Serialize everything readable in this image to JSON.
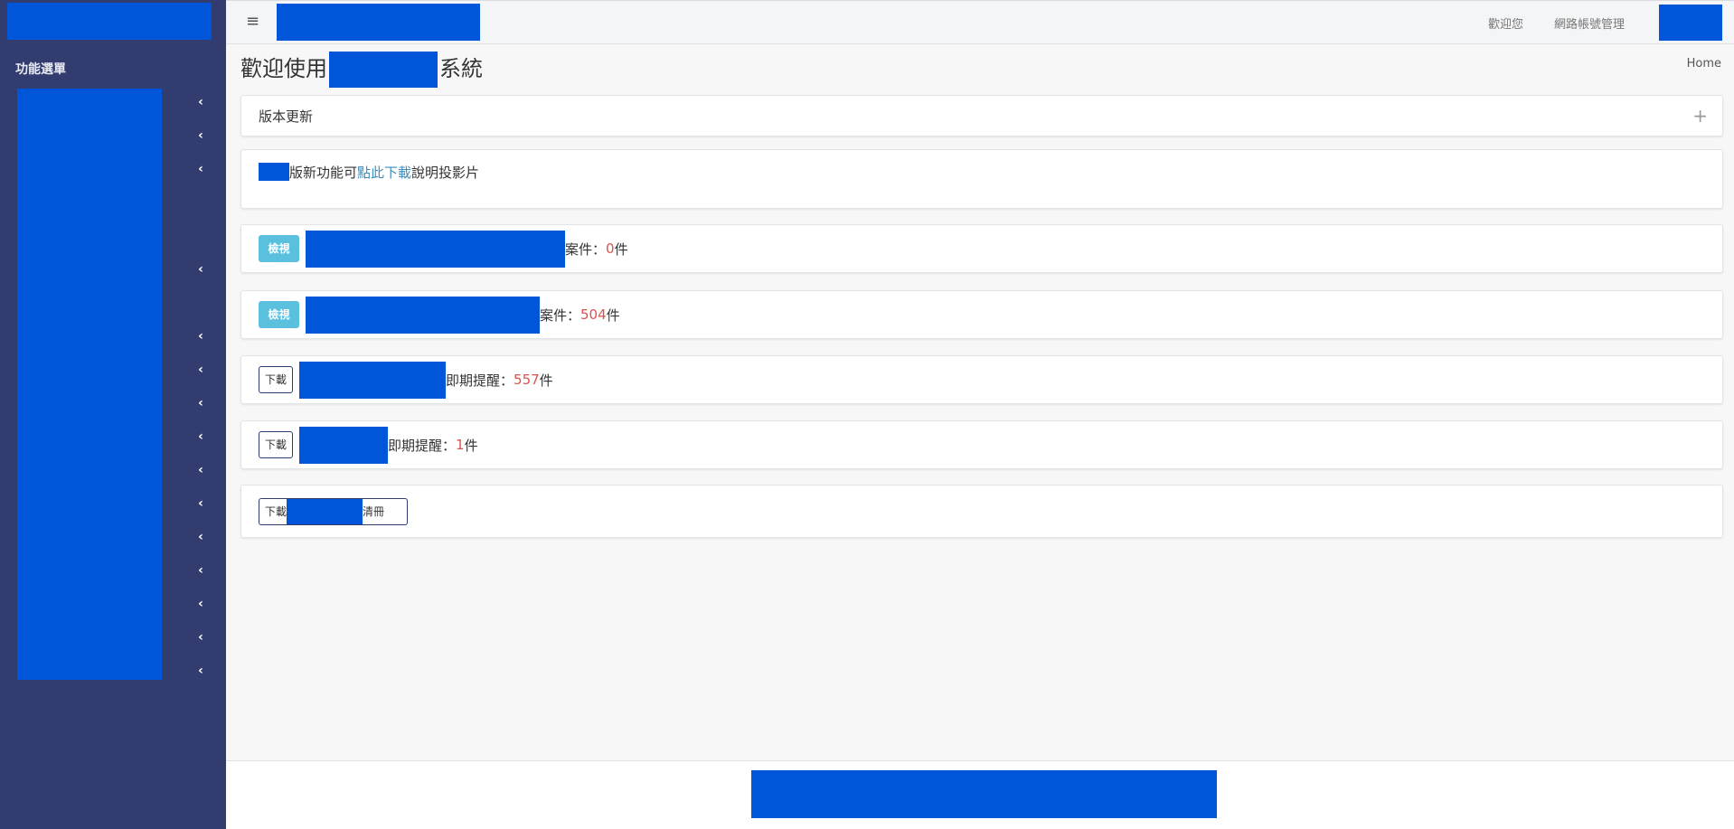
{
  "sidebar": {
    "menu_title": "功能選單",
    "chevron_count": 14
  },
  "topbar": {
    "menu_toggle": "≡",
    "welcome": "歡迎您",
    "account_management": "網路帳號管理"
  },
  "page": {
    "title_prefix": "歡迎使用",
    "title_suffix": "系統",
    "breadcrumb": "Home"
  },
  "cards": {
    "version_update": {
      "title": "版本更新",
      "expand_icon": "+"
    },
    "new_feature": {
      "text_before": "版新功能可",
      "link": "點此下載",
      "text_after": "說明投影片"
    },
    "view_case_1": {
      "button": "檢視",
      "label": "案件：",
      "count": "0",
      "unit": "件"
    },
    "view_case_2": {
      "button": "檢視",
      "label": "案件：",
      "count": "504",
      "unit": "件"
    },
    "download_reminder_1": {
      "button": "下載",
      "label": "即期提醒：",
      "count": "557",
      "unit": "件"
    },
    "download_reminder_2": {
      "button": "下載",
      "label": "即期提醒：",
      "count": "1",
      "unit": "件"
    },
    "download_list": {
      "button_prefix": "下載",
      "button_suffix": "清冊"
    }
  },
  "colors": {
    "sidebar_bg": "#323c6e",
    "redaction": "#0055d9",
    "count_red": "#d9534f",
    "link_blue": "#3c8dbc",
    "info_button": "#5bc0de"
  }
}
